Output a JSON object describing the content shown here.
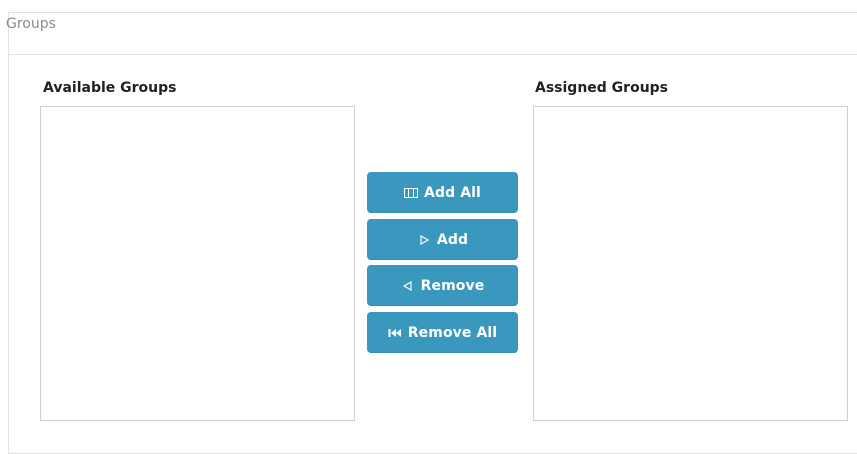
{
  "panel": {
    "title": "Groups"
  },
  "available": {
    "label": "Available Groups",
    "items": []
  },
  "assigned": {
    "label": "Assigned Groups",
    "items": []
  },
  "buttons": {
    "add_all": "Add All",
    "add": "Add",
    "remove": "Remove",
    "remove_all": "Remove All"
  },
  "colors": {
    "button_bg": "#3a98bf",
    "button_text": "#ffffff",
    "panel_title": "#8b8b8b"
  },
  "icons": {
    "add_all": "add-all-icon",
    "add": "add-icon",
    "remove": "remove-icon",
    "remove_all": "remove-all-icon"
  }
}
